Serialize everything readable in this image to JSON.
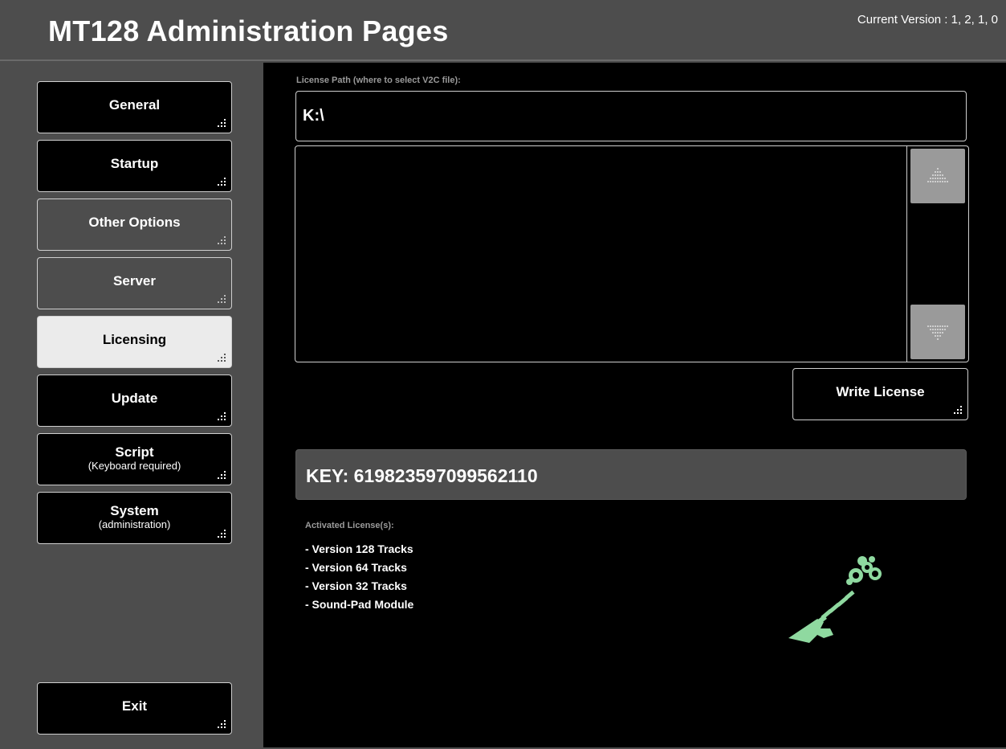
{
  "header": {
    "title": "MT128 Administration Pages",
    "version": "Current Version : 1, 2, 1, 0"
  },
  "sidebar": {
    "items": [
      {
        "label": "General",
        "sub": ""
      },
      {
        "label": "Startup",
        "sub": ""
      },
      {
        "label": "Other Options",
        "sub": ""
      },
      {
        "label": "Server",
        "sub": ""
      },
      {
        "label": "Licensing",
        "sub": ""
      },
      {
        "label": "Update",
        "sub": ""
      },
      {
        "label": "Script",
        "sub": "(Keyboard required)"
      },
      {
        "label": "System",
        "sub": "(administration)"
      }
    ],
    "exit_label": "Exit",
    "active": "Licensing"
  },
  "licensing": {
    "path_label": "License Path (where to select V2C file):",
    "path_value": "K:\\",
    "file_items": [],
    "write_button": "Write License",
    "key_text": "KEY: 619823597099562110",
    "activated_label": "Activated License(s):",
    "licenses": [
      "- Version 128 Tracks",
      "- Version 64 Tracks",
      "- Version 32 Tracks",
      "- Sound-Pad Module"
    ]
  },
  "colors": {
    "background": "#4d4d4d",
    "panel": "#000000",
    "active_tab": "#ebebeb",
    "border": "#cfcfcf",
    "muted_text": "#9a9a9a",
    "key_graphic": "#8fd9a0"
  },
  "icons": {
    "grip": "resize-grip-icon",
    "scroll_up": "arrow-up-icon",
    "scroll_down": "arrow-down-icon",
    "key": "license-key-graphic"
  }
}
